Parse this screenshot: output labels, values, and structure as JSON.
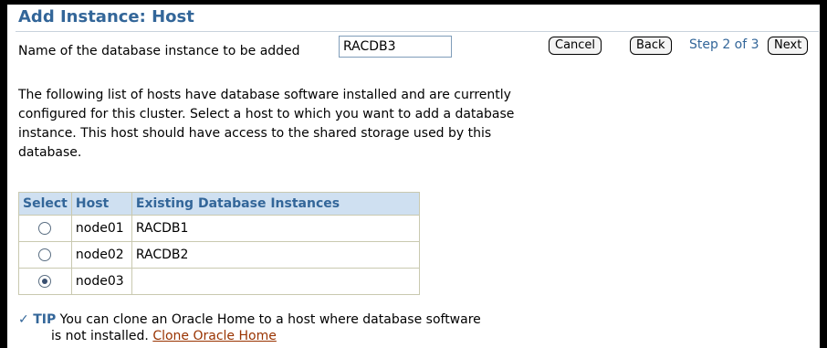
{
  "page": {
    "title": "Add Instance: Host",
    "name_label": "Name of the database instance to be added",
    "instance_name_value": "RACDB3"
  },
  "navigation": {
    "cancel_label": "Cancel",
    "back_label": "Back",
    "step_text": "Step 2 of 3",
    "next_label": "Next"
  },
  "description": "The following list of hosts have database software installed and are currently configured for this cluster. Select a host to which you want to add a database instance. This host should have access to the shared storage used by this database.",
  "table": {
    "headers": [
      "Select",
      "Host",
      "Existing Database Instances"
    ],
    "rows": [
      {
        "host": "node01",
        "instances": "RACDB1",
        "selected": false
      },
      {
        "host": "node02",
        "instances": "RACDB2",
        "selected": false
      },
      {
        "host": "node03",
        "instances": "",
        "selected": true
      }
    ]
  },
  "tip": {
    "label": "TIP",
    "text_line1": "You can clone an Oracle Home to a host where database software",
    "text_line2": "is not installed.",
    "link_label": "Clone Oracle Home"
  },
  "colors": {
    "title": "#336699",
    "header_bg": "#cfe0f1",
    "link": "#993300"
  }
}
